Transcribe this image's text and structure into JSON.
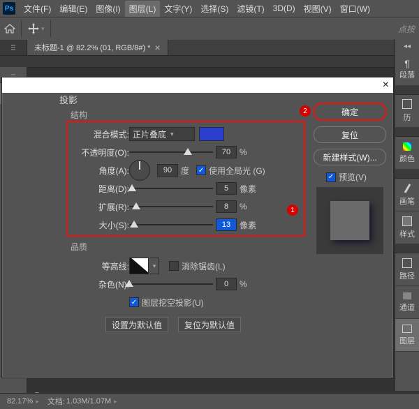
{
  "menu": {
    "items": [
      "文件(F)",
      "编辑(E)",
      "图像(I)",
      "图层(L)",
      "文字(Y)",
      "选择(S)",
      "滤镜(T)",
      "3D(D)",
      "视图(V)",
      "窗口(W)"
    ],
    "active_index": 3
  },
  "optbar": {
    "right_placeholder": "点按"
  },
  "tab": {
    "label": "未标题-1 @ 82.2% (01, RGB/8#) *"
  },
  "right_panels": {
    "items": [
      "段落",
      "历",
      "颜色",
      "画笔",
      "样式",
      "路径",
      "通道",
      "图层"
    ],
    "active_index": 7
  },
  "statusbar": {
    "zoom": "82.17%",
    "doc": "文档:",
    "size": "1.03M/1.07M"
  },
  "dialog": {
    "title": "投影",
    "structure_label": "结构",
    "blend": {
      "label": "混合模式:",
      "value": "正片叠底"
    },
    "opacity": {
      "label": "不透明度(O):",
      "value": "70",
      "unit": "%"
    },
    "angle": {
      "label": "角度(A):",
      "value": "90",
      "unit": "度"
    },
    "global_light": {
      "label": "使用全局光 (G)"
    },
    "distance": {
      "label": "距离(D):",
      "value": "5",
      "unit": "像素"
    },
    "spread": {
      "label": "扩展(R):",
      "value": "8",
      "unit": "%"
    },
    "size": {
      "label": "大小(S):",
      "value": "13",
      "unit": "像素"
    },
    "quality_label": "品质",
    "contour": {
      "label": "等高线:"
    },
    "antialias": {
      "label": "消除锯齿(L)"
    },
    "noise": {
      "label": "杂色(N):",
      "value": "0",
      "unit": "%"
    },
    "knockout": {
      "label": "图层挖空投影(U)"
    },
    "set_default": "设置为默认值",
    "reset_default": "复位为默认值",
    "buttons": {
      "ok": "确定",
      "reset": "复位",
      "new_style": "新建样式(W)..."
    },
    "preview_label": "预览(V)"
  },
  "badges": {
    "one": "1",
    "two": "2"
  }
}
